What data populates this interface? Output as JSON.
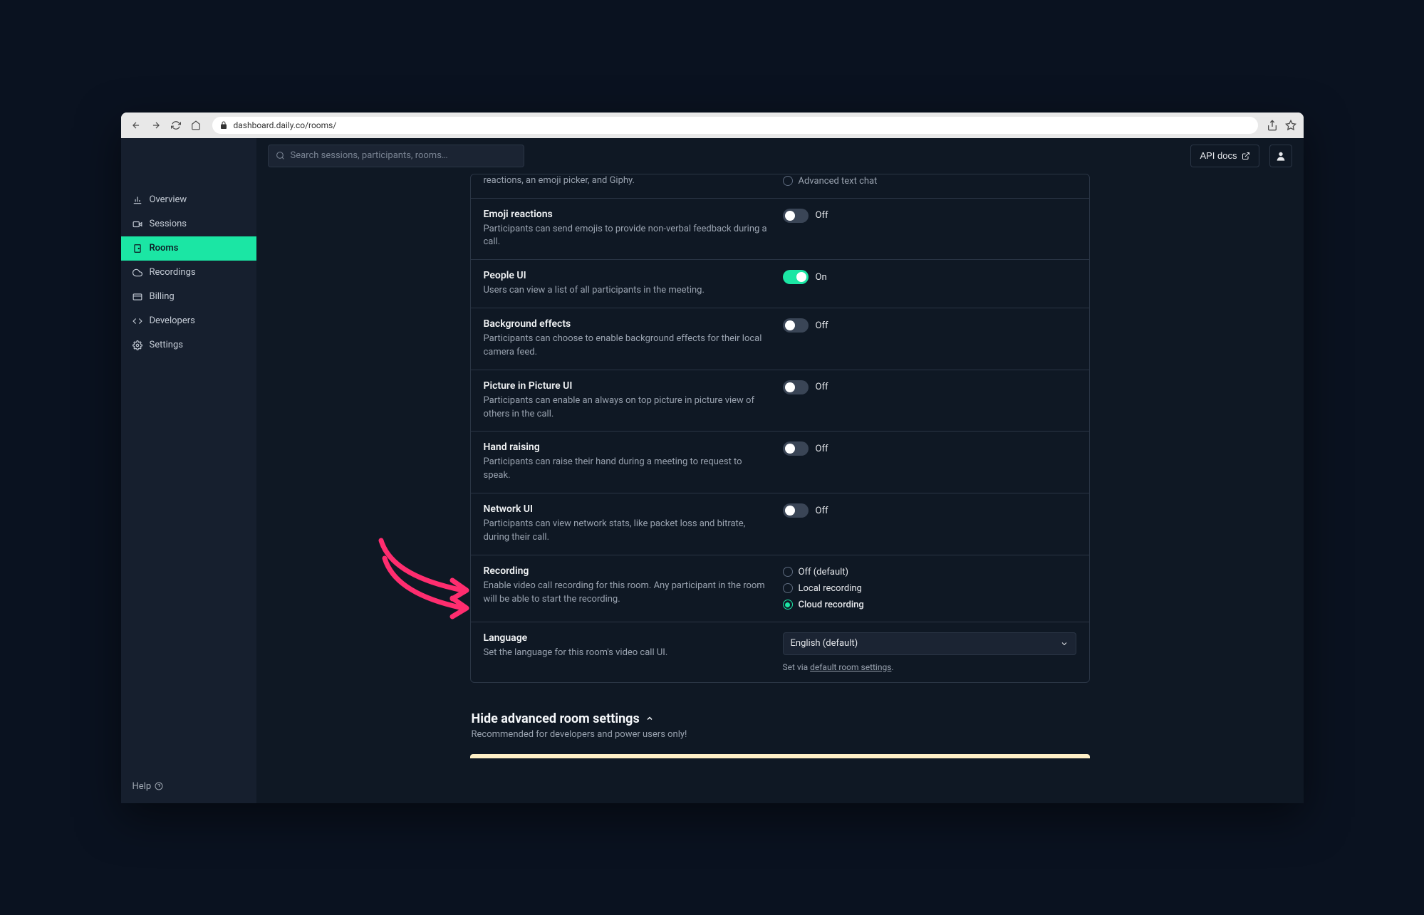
{
  "browser": {
    "url": "dashboard.daily.co/rooms/"
  },
  "search": {
    "placeholder": "Search sessions, participants, rooms…"
  },
  "topbar": {
    "api_docs": "API docs"
  },
  "sidebar": {
    "items": [
      {
        "label": "Overview",
        "icon": "bar-chart"
      },
      {
        "label": "Sessions",
        "icon": "video"
      },
      {
        "label": "Rooms",
        "icon": "door",
        "active": true
      },
      {
        "label": "Recordings",
        "icon": "cloud"
      },
      {
        "label": "Billing",
        "icon": "card"
      },
      {
        "label": "Developers",
        "icon": "code"
      },
      {
        "label": "Settings",
        "icon": "gear"
      }
    ],
    "help": "Help"
  },
  "partial_row": {
    "desc_fragment": "reactions, an emoji picker, and Giphy.",
    "option_visible": "Advanced text chat"
  },
  "settings": [
    {
      "title": "Emoji reactions",
      "desc": "Participants can send emojis to provide non-verbal feedback during a call.",
      "type": "toggle",
      "value": false,
      "off": "Off",
      "on": "On"
    },
    {
      "title": "People UI",
      "desc": "Users can view a list of all participants in the meeting.",
      "type": "toggle",
      "value": true,
      "off": "Off",
      "on": "On"
    },
    {
      "title": "Background effects",
      "desc": "Participants can choose to enable background effects for their local camera feed.",
      "type": "toggle",
      "value": false,
      "off": "Off",
      "on": "On"
    },
    {
      "title": "Picture in Picture UI",
      "desc": "Participants can enable an always on top picture in picture view of others in the call.",
      "type": "toggle",
      "value": false,
      "off": "Off",
      "on": "On"
    },
    {
      "title": "Hand raising",
      "desc": "Participants can raise their hand during a meeting to request to speak.",
      "type": "toggle",
      "value": false,
      "off": "Off",
      "on": "On"
    },
    {
      "title": "Network UI",
      "desc": "Participants can view network stats, like packet loss and bitrate, during their call.",
      "type": "toggle",
      "value": false,
      "off": "Off",
      "on": "On"
    },
    {
      "title": "Recording",
      "desc": "Enable video call recording for this room. Any participant in the room will be able to start the recording.",
      "type": "radio",
      "options": [
        "Off (default)",
        "Local recording",
        "Cloud recording"
      ],
      "selected": 2
    },
    {
      "title": "Language",
      "desc": "Set the language for this room's video call UI.",
      "type": "select",
      "value": "English (default)",
      "hint_prefix": "Set via ",
      "hint_link": "default room settings"
    }
  ],
  "expand": {
    "title": "Hide advanced room settings",
    "subtitle": "Recommended for developers and power users only!"
  }
}
